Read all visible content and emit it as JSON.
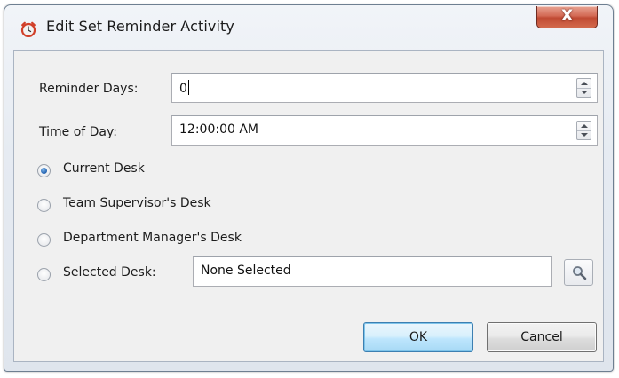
{
  "window": {
    "title": "Edit Set Reminder Activity",
    "icon": "alarm-clock-icon",
    "close_label": "X"
  },
  "reminder_days": {
    "label": "Reminder Days:",
    "value": "0"
  },
  "time_of_day": {
    "label": "Time of Day:",
    "value": "12:00:00 AM"
  },
  "desk_options": [
    {
      "label": "Current Desk",
      "checked": true
    },
    {
      "label": "Team Supervisor's Desk",
      "checked": false
    },
    {
      "label": "Department Manager's Desk",
      "checked": false
    },
    {
      "label": "Selected Desk:",
      "checked": false
    }
  ],
  "selected_desk": {
    "value": "None Selected",
    "search_icon": "magnifier-icon"
  },
  "buttons": {
    "ok": "OK",
    "cancel": "Cancel"
  },
  "colors": {
    "close_button": "#c8503a",
    "radio_selected": "#1f5fae",
    "default_button_border": "#3c7fb1"
  }
}
